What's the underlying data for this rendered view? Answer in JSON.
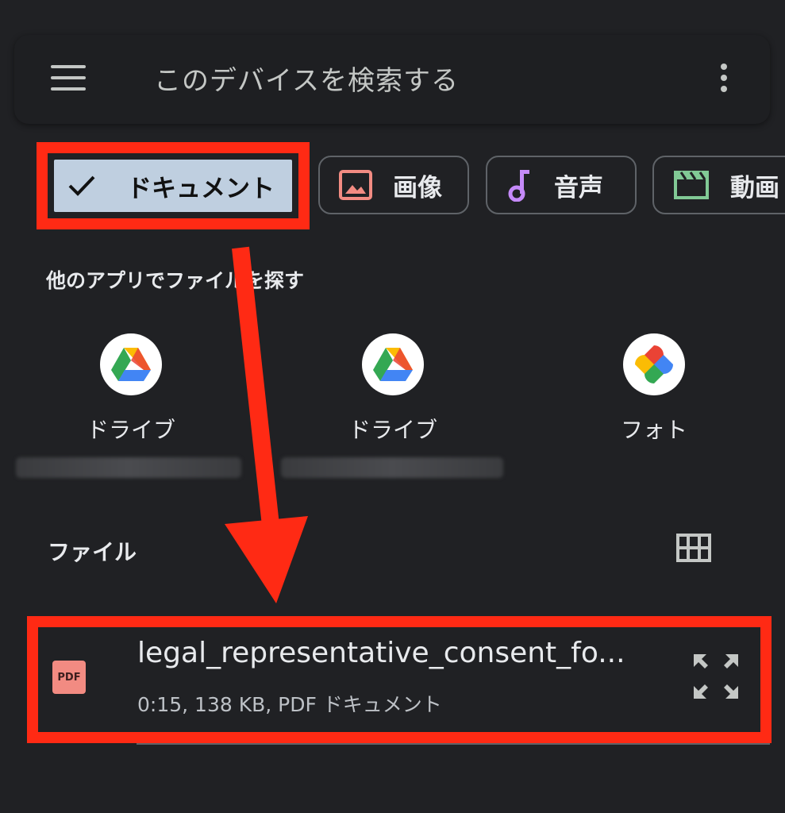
{
  "search": {
    "placeholder": "このデバイスを検索する"
  },
  "chips": {
    "documents": "ドキュメント",
    "images": "画像",
    "audio": "音声",
    "video": "動画"
  },
  "apps_section": {
    "title": "他のアプリでファイルを探す"
  },
  "apps": [
    {
      "label": "ドライブ",
      "icon": "google-drive-icon"
    },
    {
      "label": "ドライブ",
      "icon": "google-drive-icon"
    },
    {
      "label": "フォト",
      "icon": "google-photos-icon"
    }
  ],
  "files_section": {
    "title": "ファイル"
  },
  "files": [
    {
      "name": "legal_representative_consent_fo...",
      "meta": "0:15, 138 KB, PDF ドキュメント",
      "type_badge": "PDF"
    }
  ],
  "colors": {
    "background": "#202124",
    "highlight_red": "#ff2a14",
    "selected_chip": "#bfcfe0",
    "images_icon": "#f28b82",
    "audio_icon": "#c58af9",
    "video_icon": "#81c995"
  }
}
